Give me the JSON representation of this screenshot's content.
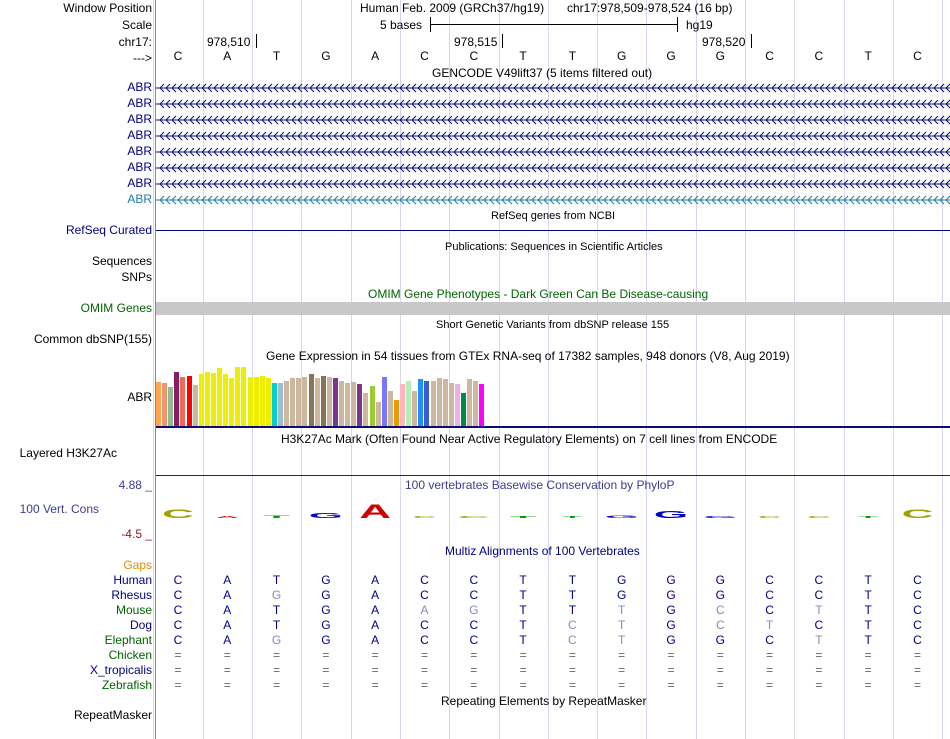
{
  "header": {
    "window_position_label": "Window Position",
    "scale_label": "Scale",
    "chrom_label": "chr17:",
    "arrow_label": "--->",
    "assembly": "Human Feb. 2009 (GRCh37/hg19)",
    "position": "chr17:978,509-978,524 (16 bp)",
    "scale_text": "5 bases",
    "scale_db": "hg19",
    "ticks": [
      "978,510",
      "978,515",
      "978,520"
    ]
  },
  "sequence": [
    "C",
    "A",
    "T",
    "G",
    "A",
    "C",
    "C",
    "T",
    "T",
    "G",
    "G",
    "G",
    "C",
    "C",
    "T",
    "C"
  ],
  "gencode": {
    "title": "GENCODE V49lift37 (5 items filtered out)",
    "genes": [
      "ABR",
      "ABR",
      "ABR",
      "ABR",
      "ABR",
      "ABR",
      "ABR",
      "ABR"
    ]
  },
  "refseq": {
    "title": "RefSeq genes from NCBI",
    "label": "RefSeq Curated"
  },
  "publications": {
    "title": "Publications: Sequences in Scientific Articles",
    "label_line1": "Sequences",
    "label_line2": "SNPs"
  },
  "omim": {
    "title": "OMIM Gene Phenotypes - Dark Green Can Be Disease-causing",
    "label": "OMIM Genes"
  },
  "dbsnp": {
    "title": "Short Genetic Variants from dbSNP release 155",
    "label": "Common dbSNP(155)"
  },
  "gtex": {
    "title": "Gene Expression in 54 tissues from GTEx RNA-seq of 17382 samples, 948 donors (V8, Aug 2019)",
    "label": "ABR",
    "colors": [
      "#FFA54F",
      "#EE9572",
      "#8FBC8F",
      "#8B1C62",
      "#EE6A50",
      "#FF0000",
      "#CDB79E",
      "#EEEE00",
      "#EEEE00",
      "#EEEE00",
      "#EEEE00",
      "#EEEE00",
      "#EEEE00",
      "#EEEE00",
      "#EEEE00",
      "#EEEE00",
      "#EEEE00",
      "#EEEE00",
      "#EEEE00",
      "#00CED1",
      "#9AC0CD",
      "#CDB79E",
      "#CDB79E",
      "#CDB79E",
      "#CDB79E",
      "#8B7355",
      "#CDB79E",
      "#8B7355",
      "#CDB79E",
      "#7A378B",
      "#CDB79E",
      "#CDB79E",
      "#CDB79E",
      "#7A378B",
      "#CDB79E",
      "#9ACD32",
      "#CDB79E",
      "#7777FF",
      "#CDB79E",
      "#EE9A00",
      "#FFB6C1",
      "#B4EEB4",
      "#CDB79E",
      "#1E90FF",
      "#3A5FCD",
      "#CDB79E",
      "#CDB79E",
      "#CDB79E",
      "#CDB79E",
      "#EEAEEE",
      "#008B45",
      "#CDB79E",
      "#CDB79E",
      "#FF00FF"
    ],
    "values": [
      0.7,
      0.68,
      0.62,
      0.85,
      0.78,
      0.8,
      0.65,
      0.82,
      0.86,
      0.84,
      0.92,
      0.82,
      0.76,
      0.94,
      0.93,
      0.78,
      0.78,
      0.8,
      0.76,
      0.68,
      0.68,
      0.72,
      0.76,
      0.76,
      0.78,
      0.82,
      0.76,
      0.8,
      0.78,
      0.76,
      0.72,
      0.68,
      0.7,
      0.66,
      0.52,
      0.64,
      0.38,
      0.78,
      0.55,
      0.42,
      0.66,
      0.72,
      0.56,
      0.74,
      0.72,
      0.72,
      0.76,
      0.74,
      0.68,
      0.66,
      0.52,
      0.74,
      0.72,
      0.66
    ]
  },
  "h3k27ac": {
    "title": "H3K27Ac Mark (Often Found Near Active Regulatory Elements) on 7 cell lines from ENCODE",
    "label": "Layered H3K27Ac"
  },
  "phylop": {
    "title": "100 vertebrates Basewise Conservation by PhyloP",
    "label": "100 Vert. Cons",
    "max": "4.88 _",
    "min": "-4.5 _",
    "scores": [
      2.2,
      -0.2,
      0.6,
      1.4,
      3.6,
      -0.1,
      0.15,
      0.3,
      -0.1,
      0.7,
      1.9,
      0.2,
      -0.3,
      -0.1,
      -0.1,
      2.3
    ]
  },
  "multiz": {
    "title": "Multiz Alignments of 100 Vertebrates",
    "gaps_label": "Gaps",
    "species": [
      {
        "name": "Human",
        "bases": [
          "C",
          "A",
          "T",
          "G",
          "A",
          "C",
          "C",
          "T",
          "T",
          "G",
          "G",
          "G",
          "C",
          "C",
          "T",
          "C"
        ]
      },
      {
        "name": "Rhesus",
        "bases": [
          "C",
          "A",
          "G",
          "G",
          "A",
          "C",
          "C",
          "T",
          "T",
          "G",
          "G",
          "G",
          "C",
          "C",
          "T",
          "C"
        ]
      },
      {
        "name": "Mouse",
        "bases": [
          "C",
          "A",
          "T",
          "G",
          "A",
          "A",
          "G",
          "T",
          "T",
          "T",
          "G",
          "C",
          "C",
          "T",
          "T",
          "C"
        ]
      },
      {
        "name": "Dog",
        "bases": [
          "C",
          "A",
          "T",
          "G",
          "A",
          "C",
          "C",
          "T",
          "C",
          "T",
          "G",
          "C",
          "T",
          "C",
          "T",
          "C"
        ]
      },
      {
        "name": "Elephant",
        "bases": [
          "C",
          "A",
          "G",
          "G",
          "A",
          "C",
          "C",
          "T",
          "C",
          "T",
          "G",
          "G",
          "C",
          "T",
          "T",
          "C"
        ]
      },
      {
        "name": "Chicken",
        "bases": [
          "=",
          "=",
          "=",
          "=",
          "=",
          "=",
          "=",
          "=",
          "=",
          "=",
          "=",
          "=",
          "=",
          "=",
          "=",
          "="
        ]
      },
      {
        "name": "X_tropicalis",
        "bases": [
          "=",
          "=",
          "=",
          "=",
          "=",
          "=",
          "=",
          "=",
          "=",
          "=",
          "=",
          "=",
          "=",
          "=",
          "=",
          "="
        ]
      },
      {
        "name": "Zebrafish",
        "bases": [
          "=",
          "=",
          "=",
          "=",
          "=",
          "=",
          "=",
          "=",
          "=",
          "=",
          "=",
          "=",
          "=",
          "=",
          "=",
          "="
        ]
      }
    ]
  },
  "repeatmasker": {
    "title": "Repeating Elements by RepeatMasker",
    "label": "RepeatMasker"
  },
  "colors": {
    "navy": "#000080",
    "gene_dark": "#0c0c78",
    "gene_light": "#1c7ca0",
    "green": "#006400",
    "omim_bar": "#c8c8c8",
    "h3k_line": "#8b0000",
    "phylop_blue": "#3c3c96",
    "phylop_red": "#8b1a1a",
    "gaps": "#e08a00",
    "grid": "#d6d6ee"
  }
}
